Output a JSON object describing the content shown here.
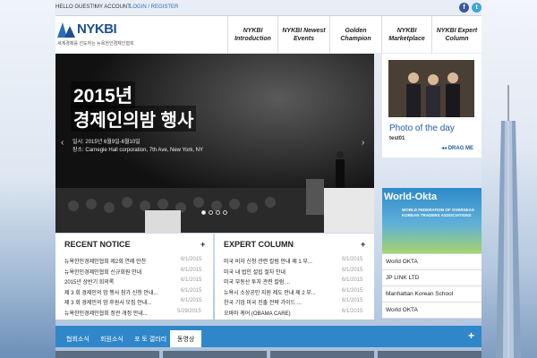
{
  "topbar": {
    "guest": "HELLO GUEST!!",
    "my_account": "MY ACCOUNT",
    "login": "LOGIN / REGISTER",
    "facebook_icon": "f",
    "twitter_icon": "t"
  },
  "header": {
    "logo_text": "NYKBI",
    "logo_tagline": "세계경제를 선도하는 뉴욕한인경제인협회",
    "nav": [
      {
        "label": "NYKBI Introduction"
      },
      {
        "label": "NYKBI Newest Events"
      },
      {
        "label": "Golden Champion"
      },
      {
        "label": "NYKBI Marketplace"
      },
      {
        "label": "NYKBI Expert Column"
      }
    ]
  },
  "slider": {
    "title_line1": "2015년",
    "title_line2": "경제인의밤 행사",
    "date": "일시: 2015년 6월9일-6월10일",
    "place": "장소: Carnegie Hall corporation, 7th Ave, New York, NY",
    "prev": "‹",
    "next": "›"
  },
  "photo": {
    "title": "Photo of the day",
    "user": "test01",
    "drag": "◂◂ DRAG ME"
  },
  "ad": {
    "title": "World-Okta",
    "subtitle": "WORLD FEDERATION OF OVERSEAS KOREAN TRADERS ASSOCIATIONS"
  },
  "links": [
    "World OKTA",
    "JP LINK LTD",
    "Manhattan Korean School",
    "World OKTA"
  ],
  "recent_notice": {
    "heading": "RECENT NOTICE",
    "plus": "+",
    "items": [
      {
        "title": "뉴욕한인경제인협회 제2회 연례 만찬",
        "date": "6/1/2015"
      },
      {
        "title": "뉴욕한인경제인협회 신규회원 안내",
        "date": "6/1/2015"
      },
      {
        "title": "2015년 상반기 회의록",
        "date": "6/1/2015"
      },
      {
        "title": "제 3 회 경제인의 밤 행사 참가 신청 안내...",
        "date": "6/1/2015"
      },
      {
        "title": "제 3 회 경제인의 밤 후원사 모집 안내...",
        "date": "6/1/2015"
      },
      {
        "title": "뉴욕한인경제인협회 정관 개정 안내...",
        "date": "5/29/2015"
      }
    ]
  },
  "expert_column": {
    "heading": "EXPERT COLUMN",
    "plus": "+",
    "items": [
      {
        "title": "미국 비자 신청 관련 칼럼 안내 제 1 부...",
        "date": "6/1/2015"
      },
      {
        "title": "미국 내 법인 설립 절차 안내",
        "date": "6/1/2015"
      },
      {
        "title": "미국 부동산 투자 관련 칼럼 ...",
        "date": "6/1/2015"
      },
      {
        "title": "뉴욕시 소상공인 지원 제도 안내 제 2 부...",
        "date": "6/1/2015"
      },
      {
        "title": "한국 기업 미국 진출 전략 가이드 ...",
        "date": "6/1/2015"
      },
      {
        "title": "오바마 케어 (OBAMA CARE)",
        "date": "6/1/2015"
      }
    ]
  },
  "tabs": [
    {
      "label": "협회소식"
    },
    {
      "label": "회원소식"
    },
    {
      "label": "포 토 갤러리"
    },
    {
      "label": "동영상"
    }
  ],
  "tabs_plus": "+",
  "colors": {
    "accent": "#2f87c9",
    "brand": "#1f4f94"
  }
}
